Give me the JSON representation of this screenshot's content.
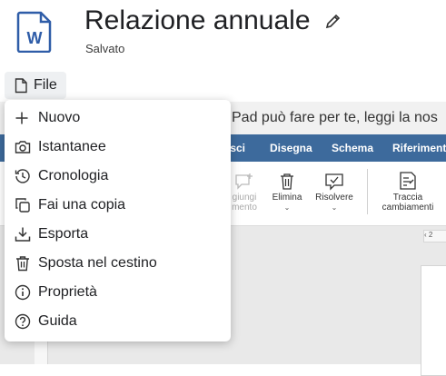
{
  "header": {
    "title": "Relazione annuale",
    "status": "Salvato",
    "doc_icon_letter": "W"
  },
  "file_button": {
    "label": "File"
  },
  "background": {
    "message": "Pad può fare per te, leggi la nos",
    "tabs": [
      "isci",
      "Disegna",
      "Schema",
      "Riferimenti"
    ],
    "tools": {
      "add_comment": "giungi\nmento",
      "delete": "Elimina",
      "resolve": "Risolvere",
      "track_changes": "Traccia\ncambiamenti"
    },
    "page_number": "‹ 2"
  },
  "menu": {
    "items": [
      {
        "label": "Nuovo",
        "icon": "plus-icon"
      },
      {
        "label": "Istantanee",
        "icon": "camera-icon"
      },
      {
        "label": "Cronologia",
        "icon": "history-icon"
      },
      {
        "label": "Fai una copia",
        "icon": "copy-icon"
      },
      {
        "label": "Esporta",
        "icon": "download-icon"
      },
      {
        "label": "Sposta nel cestino",
        "icon": "trash-icon"
      },
      {
        "label": "Proprietà",
        "icon": "info-icon"
      },
      {
        "label": "Guida",
        "icon": "help-icon"
      }
    ]
  },
  "colors": {
    "ribbon": "#3d6a9c",
    "doc_icon": "#2f5da8"
  }
}
